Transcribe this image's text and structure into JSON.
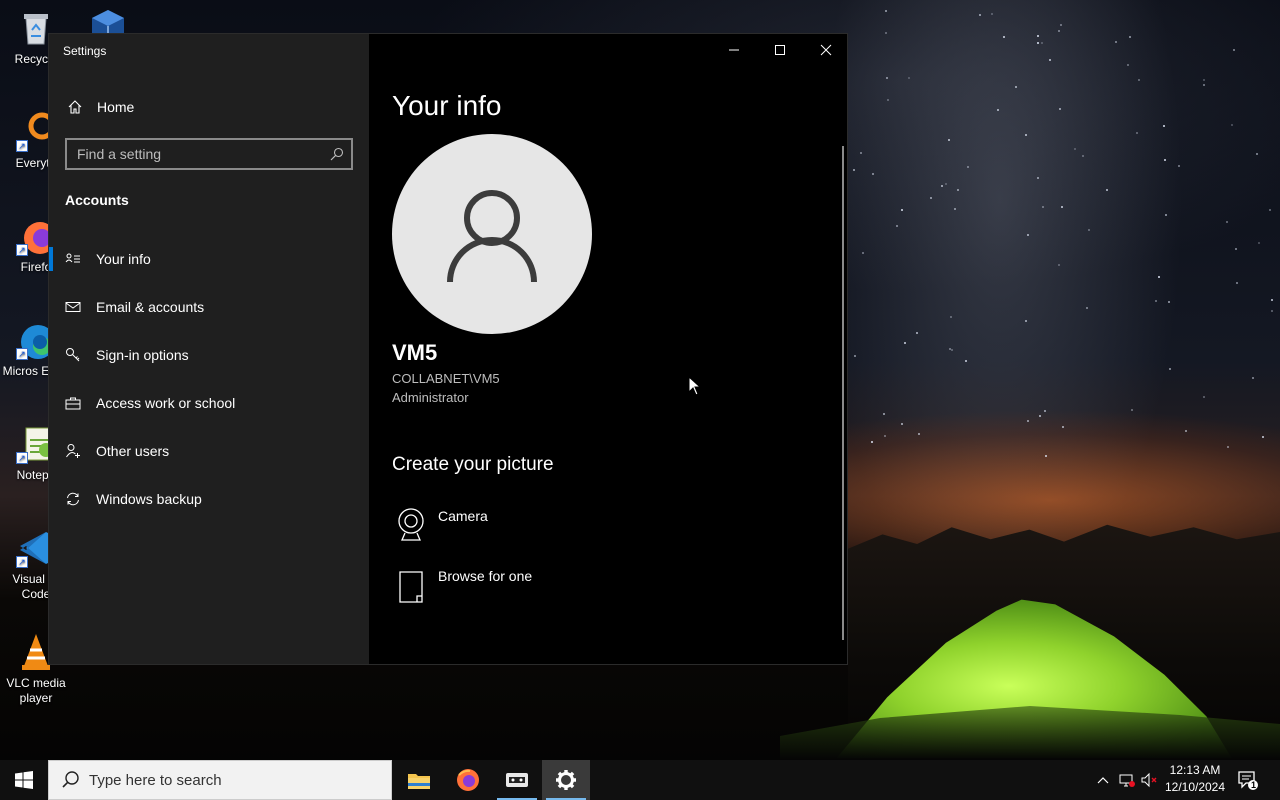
{
  "desktop": {
    "icons": [
      {
        "label": "Recycle"
      },
      {
        "label": "Everyth"
      },
      {
        "label": "Firefo"
      },
      {
        "label": "Micros Edge"
      },
      {
        "label": "Notepa"
      },
      {
        "label": "Visual St Code"
      },
      {
        "label": "VLC media player"
      }
    ]
  },
  "window": {
    "title": "Settings",
    "nav": {
      "home_label": "Home",
      "search_placeholder": "Find a setting",
      "section_heading": "Accounts",
      "items": [
        {
          "label": "Your info",
          "icon": "contact-card-icon",
          "selected": true
        },
        {
          "label": "Email & accounts",
          "icon": "mail-icon",
          "selected": false
        },
        {
          "label": "Sign-in options",
          "icon": "key-icon",
          "selected": false
        },
        {
          "label": "Access work or school",
          "icon": "briefcase-icon",
          "selected": false
        },
        {
          "label": "Other users",
          "icon": "add-user-icon",
          "selected": false
        },
        {
          "label": "Windows backup",
          "icon": "sync-icon",
          "selected": false
        }
      ]
    },
    "content": {
      "page_title": "Your info",
      "user_name": "VM5",
      "user_domain": "COLLABNET\\VM5",
      "user_role": "Administrator",
      "create_picture_title": "Create your picture",
      "options": [
        {
          "label": "Camera",
          "icon": "camera-icon"
        },
        {
          "label": "Browse for one",
          "icon": "document-icon"
        }
      ]
    },
    "accent_color": "#0078d7"
  },
  "taskbar": {
    "search_placeholder": "Type here to search",
    "apps": [
      "file-explorer-icon",
      "firefox-icon",
      "virtualbox-icon",
      "settings-gear-icon"
    ],
    "clock_time": "12:13 AM",
    "clock_date": "12/10/2024",
    "notification_count": "1"
  }
}
